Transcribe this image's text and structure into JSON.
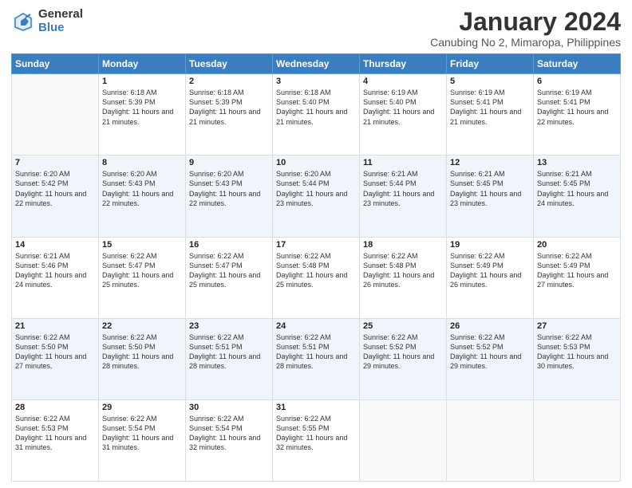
{
  "logo": {
    "general": "General",
    "blue": "Blue"
  },
  "title": "January 2024",
  "subtitle": "Canubing No 2, Mimaropa, Philippines",
  "headers": [
    "Sunday",
    "Monday",
    "Tuesday",
    "Wednesday",
    "Thursday",
    "Friday",
    "Saturday"
  ],
  "weeks": [
    [
      {
        "day": "",
        "sunrise": "",
        "sunset": "",
        "daylight": ""
      },
      {
        "day": "1",
        "sunrise": "Sunrise: 6:18 AM",
        "sunset": "Sunset: 5:39 PM",
        "daylight": "Daylight: 11 hours and 21 minutes."
      },
      {
        "day": "2",
        "sunrise": "Sunrise: 6:18 AM",
        "sunset": "Sunset: 5:39 PM",
        "daylight": "Daylight: 11 hours and 21 minutes."
      },
      {
        "day": "3",
        "sunrise": "Sunrise: 6:18 AM",
        "sunset": "Sunset: 5:40 PM",
        "daylight": "Daylight: 11 hours and 21 minutes."
      },
      {
        "day": "4",
        "sunrise": "Sunrise: 6:19 AM",
        "sunset": "Sunset: 5:40 PM",
        "daylight": "Daylight: 11 hours and 21 minutes."
      },
      {
        "day": "5",
        "sunrise": "Sunrise: 6:19 AM",
        "sunset": "Sunset: 5:41 PM",
        "daylight": "Daylight: 11 hours and 21 minutes."
      },
      {
        "day": "6",
        "sunrise": "Sunrise: 6:19 AM",
        "sunset": "Sunset: 5:41 PM",
        "daylight": "Daylight: 11 hours and 22 minutes."
      }
    ],
    [
      {
        "day": "7",
        "sunrise": "Sunrise: 6:20 AM",
        "sunset": "Sunset: 5:42 PM",
        "daylight": "Daylight: 11 hours and 22 minutes."
      },
      {
        "day": "8",
        "sunrise": "Sunrise: 6:20 AM",
        "sunset": "Sunset: 5:43 PM",
        "daylight": "Daylight: 11 hours and 22 minutes."
      },
      {
        "day": "9",
        "sunrise": "Sunrise: 6:20 AM",
        "sunset": "Sunset: 5:43 PM",
        "daylight": "Daylight: 11 hours and 22 minutes."
      },
      {
        "day": "10",
        "sunrise": "Sunrise: 6:20 AM",
        "sunset": "Sunset: 5:44 PM",
        "daylight": "Daylight: 11 hours and 23 minutes."
      },
      {
        "day": "11",
        "sunrise": "Sunrise: 6:21 AM",
        "sunset": "Sunset: 5:44 PM",
        "daylight": "Daylight: 11 hours and 23 minutes."
      },
      {
        "day": "12",
        "sunrise": "Sunrise: 6:21 AM",
        "sunset": "Sunset: 5:45 PM",
        "daylight": "Daylight: 11 hours and 23 minutes."
      },
      {
        "day": "13",
        "sunrise": "Sunrise: 6:21 AM",
        "sunset": "Sunset: 5:45 PM",
        "daylight": "Daylight: 11 hours and 24 minutes."
      }
    ],
    [
      {
        "day": "14",
        "sunrise": "Sunrise: 6:21 AM",
        "sunset": "Sunset: 5:46 PM",
        "daylight": "Daylight: 11 hours and 24 minutes."
      },
      {
        "day": "15",
        "sunrise": "Sunrise: 6:22 AM",
        "sunset": "Sunset: 5:47 PM",
        "daylight": "Daylight: 11 hours and 25 minutes."
      },
      {
        "day": "16",
        "sunrise": "Sunrise: 6:22 AM",
        "sunset": "Sunset: 5:47 PM",
        "daylight": "Daylight: 11 hours and 25 minutes."
      },
      {
        "day": "17",
        "sunrise": "Sunrise: 6:22 AM",
        "sunset": "Sunset: 5:48 PM",
        "daylight": "Daylight: 11 hours and 25 minutes."
      },
      {
        "day": "18",
        "sunrise": "Sunrise: 6:22 AM",
        "sunset": "Sunset: 5:48 PM",
        "daylight": "Daylight: 11 hours and 26 minutes."
      },
      {
        "day": "19",
        "sunrise": "Sunrise: 6:22 AM",
        "sunset": "Sunset: 5:49 PM",
        "daylight": "Daylight: 11 hours and 26 minutes."
      },
      {
        "day": "20",
        "sunrise": "Sunrise: 6:22 AM",
        "sunset": "Sunset: 5:49 PM",
        "daylight": "Daylight: 11 hours and 27 minutes."
      }
    ],
    [
      {
        "day": "21",
        "sunrise": "Sunrise: 6:22 AM",
        "sunset": "Sunset: 5:50 PM",
        "daylight": "Daylight: 11 hours and 27 minutes."
      },
      {
        "day": "22",
        "sunrise": "Sunrise: 6:22 AM",
        "sunset": "Sunset: 5:50 PM",
        "daylight": "Daylight: 11 hours and 28 minutes."
      },
      {
        "day": "23",
        "sunrise": "Sunrise: 6:22 AM",
        "sunset": "Sunset: 5:51 PM",
        "daylight": "Daylight: 11 hours and 28 minutes."
      },
      {
        "day": "24",
        "sunrise": "Sunrise: 6:22 AM",
        "sunset": "Sunset: 5:51 PM",
        "daylight": "Daylight: 11 hours and 28 minutes."
      },
      {
        "day": "25",
        "sunrise": "Sunrise: 6:22 AM",
        "sunset": "Sunset: 5:52 PM",
        "daylight": "Daylight: 11 hours and 29 minutes."
      },
      {
        "day": "26",
        "sunrise": "Sunrise: 6:22 AM",
        "sunset": "Sunset: 5:52 PM",
        "daylight": "Daylight: 11 hours and 29 minutes."
      },
      {
        "day": "27",
        "sunrise": "Sunrise: 6:22 AM",
        "sunset": "Sunset: 5:53 PM",
        "daylight": "Daylight: 11 hours and 30 minutes."
      }
    ],
    [
      {
        "day": "28",
        "sunrise": "Sunrise: 6:22 AM",
        "sunset": "Sunset: 5:53 PM",
        "daylight": "Daylight: 11 hours and 31 minutes."
      },
      {
        "day": "29",
        "sunrise": "Sunrise: 6:22 AM",
        "sunset": "Sunset: 5:54 PM",
        "daylight": "Daylight: 11 hours and 31 minutes."
      },
      {
        "day": "30",
        "sunrise": "Sunrise: 6:22 AM",
        "sunset": "Sunset: 5:54 PM",
        "daylight": "Daylight: 11 hours and 32 minutes."
      },
      {
        "day": "31",
        "sunrise": "Sunrise: 6:22 AM",
        "sunset": "Sunset: 5:55 PM",
        "daylight": "Daylight: 11 hours and 32 minutes."
      },
      {
        "day": "",
        "sunrise": "",
        "sunset": "",
        "daylight": ""
      },
      {
        "day": "",
        "sunrise": "",
        "sunset": "",
        "daylight": ""
      },
      {
        "day": "",
        "sunrise": "",
        "sunset": "",
        "daylight": ""
      }
    ]
  ]
}
